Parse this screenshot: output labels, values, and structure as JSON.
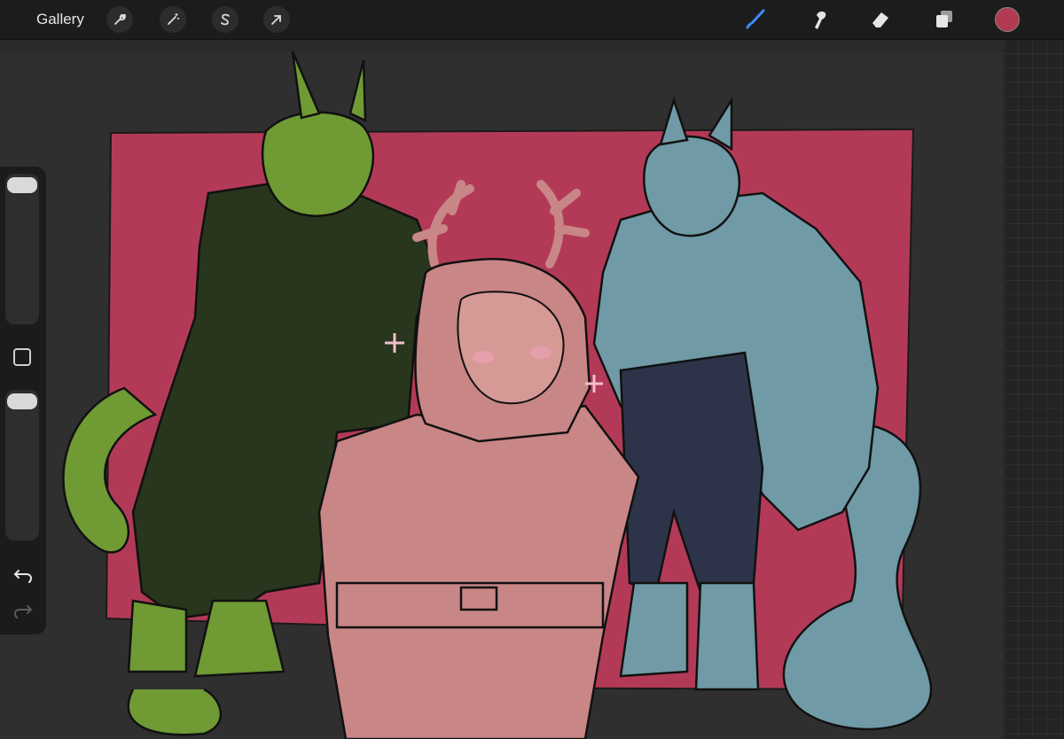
{
  "toolbar": {
    "gallery_label": "Gallery",
    "tools_left": [
      "wrench-icon",
      "magic-wand-icon",
      "selection-s-icon",
      "transform-arrow-icon"
    ],
    "tools_right": [
      "brush-icon",
      "smudge-icon",
      "eraser-icon",
      "layers-icon"
    ],
    "active_tool": "brush-icon",
    "accent_color": "#3d8bff",
    "current_color": "#b23a52"
  },
  "sidebar": {
    "size_slider_level": 0.0,
    "opacity_slider_level": 0.0,
    "modify_button": "square-modify-icon",
    "undo": "undo-icon",
    "redo": "redo-icon"
  },
  "canvas": {
    "background_color": "#2f2f2f",
    "backdrop_color": "#b33a57",
    "figures": [
      {
        "name": "green-horned-character",
        "color": "#6f9a34"
      },
      {
        "name": "pink-antlered-character",
        "color": "#c98686"
      },
      {
        "name": "blue-eared-character",
        "color": "#6f9aa6"
      }
    ]
  }
}
